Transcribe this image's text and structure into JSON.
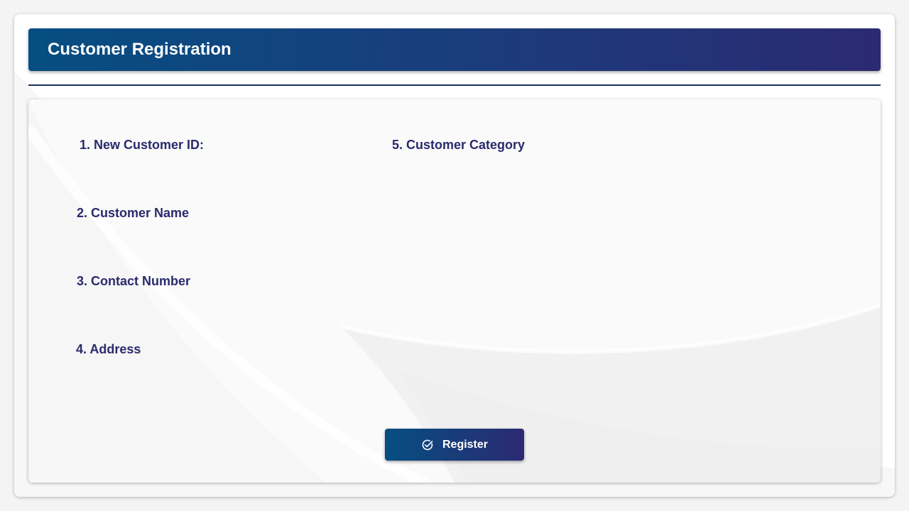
{
  "header": {
    "title": "Customer Registration"
  },
  "form": {
    "fields": [
      {
        "label": "1. New Customer ID:"
      },
      {
        "label": "2. Customer Name"
      },
      {
        "label": "3. Contact Number"
      },
      {
        "label": "4. Address"
      },
      {
        "label": "5. Customer Category"
      }
    ]
  },
  "actions": {
    "register_label": "Register",
    "register_icon": "check-circle-icon"
  },
  "colors": {
    "header_start": "#064e82",
    "header_end": "#2b2a72",
    "label_text": "#2a2a6c",
    "divider": "#17305e"
  }
}
